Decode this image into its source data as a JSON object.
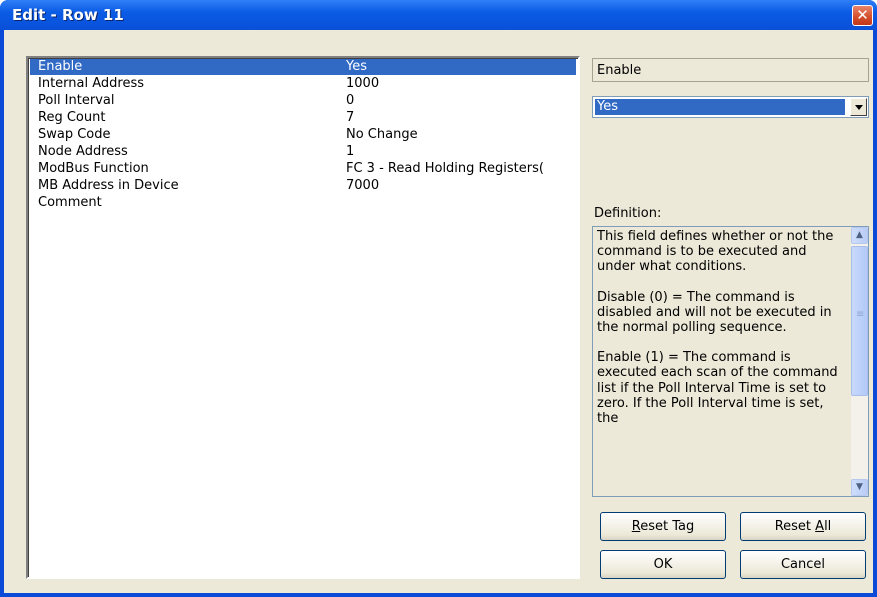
{
  "window": {
    "title": "Edit - Row 11",
    "close_glyph": "✕"
  },
  "params": [
    {
      "name": "Enable",
      "value": "Yes"
    },
    {
      "name": "Internal Address",
      "value": "1000"
    },
    {
      "name": "Poll Interval",
      "value": "0"
    },
    {
      "name": "Reg Count",
      "value": "7"
    },
    {
      "name": "Swap Code",
      "value": "No Change"
    },
    {
      "name": "Node Address",
      "value": "1"
    },
    {
      "name": "ModBus Function",
      "value": "FC 3 - Read Holding Registers("
    },
    {
      "name": "MB Address in Device",
      "value": "7000"
    },
    {
      "name": "Comment",
      "value": ""
    }
  ],
  "selected_index": 0,
  "editor": {
    "field_name": "Enable",
    "combo_value": "Yes"
  },
  "definition": {
    "label": "Definition:",
    "paragraphs": [
      "This field defines whether or not the command is to be executed and under what conditions.",
      "Disable (0) = The command is disabled and will not be executed in the normal polling sequence.",
      "Enable (1) = The command is executed each scan of the command list if the Poll Interval Time is set to zero. If the Poll Interval time is set, the"
    ]
  },
  "buttons": {
    "reset_tag": {
      "pre": "",
      "key": "R",
      "post": "eset Tag"
    },
    "reset_all": {
      "pre": "Reset ",
      "key": "A",
      "post": "ll"
    },
    "ok": "OK",
    "cancel": "Cancel"
  },
  "icons": {
    "scroll_up": "▲",
    "scroll_down": "▼"
  }
}
